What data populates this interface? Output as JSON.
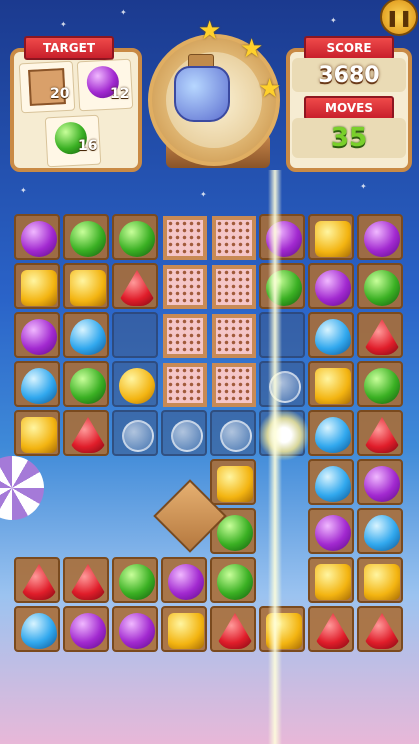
{
  "hud": {
    "target_label": "TARGET",
    "score_label": "SCORE",
    "score_value": "3680",
    "moves_label": "MOVES",
    "moves_value": "35",
    "targets": [
      {
        "icon": "cracker-block-icon",
        "count": "20"
      },
      {
        "icon": "purple-candy-icon",
        "count": "12"
      },
      {
        "icon": "green-candy-icon",
        "count": "16"
      }
    ],
    "stars_earned": 3,
    "pause_icon": "pause-icon"
  },
  "board": {
    "rows": [
      [
        "purple",
        "green",
        "green",
        "cracker",
        "cracker",
        "purple",
        "yellow",
        "purple"
      ],
      [
        "yellow",
        "yellow",
        "red",
        "cracker",
        "cracker",
        "green",
        "purple",
        "green"
      ],
      [
        "purple",
        "blue",
        "empty",
        "cracker",
        "cracker",
        "empty",
        "blue",
        "red"
      ],
      [
        "blue",
        "green",
        "wrapped",
        "cracker",
        "cracker",
        "bubble",
        "yellow",
        "green"
      ],
      [
        "yellow",
        "red",
        "bubble",
        "bubble",
        "bubble",
        "burst",
        "blue",
        "red"
      ],
      [
        "none",
        "none",
        "none",
        "none",
        "yellow",
        "none",
        "blue",
        "purple"
      ],
      [
        "none",
        "none",
        "none",
        "none",
        "green",
        "none",
        "purple",
        "blue"
      ],
      [
        "red",
        "red",
        "green",
        "purple",
        "green",
        "none",
        "yellow",
        "yellow"
      ],
      [
        "blue",
        "purple",
        "purple",
        "yellow",
        "red",
        "yellow",
        "red",
        "red"
      ]
    ]
  },
  "colors": {
    "accent": "#c81f2b",
    "moves": "#7ad02b",
    "frame": "#c98a45"
  }
}
